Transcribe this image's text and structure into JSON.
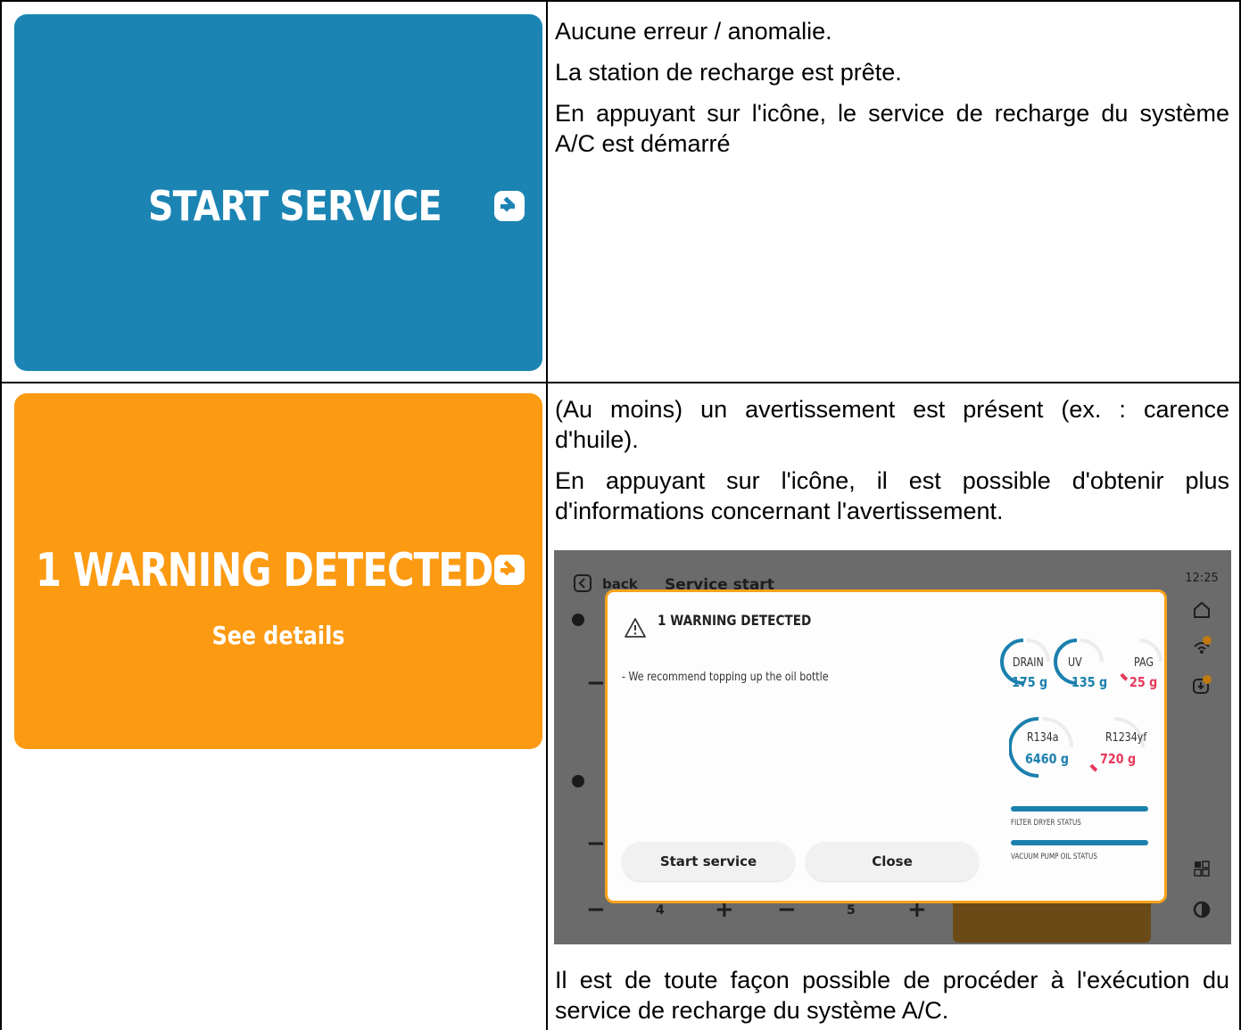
{
  "row1": {
    "tile_label": "START SERVICE",
    "paragraphs": [
      "Aucune erreur / anomalie.",
      "La station de recharge est prête.",
      "En appuyant sur l'icône, le service de recharge du système A/C est démarré"
    ]
  },
  "row2": {
    "tile_label": "1 WARNING DETECTED",
    "tile_sublabel": "See details",
    "paragraphs": [
      "(Au moins) un avertissement est présent (ex. : carence d'huile).",
      "En appuyant sur l'icône, il est possible d'obtenir plus d'informations concernant l'avertissement.",
      "Il est de toute façon possible de procéder à l'exécution du service de recharge du système A/C."
    ]
  },
  "screenshot": {
    "back_label": "back",
    "page_title": "Service start",
    "time": "12:25",
    "stepper_values": [
      "4",
      "5"
    ],
    "modal": {
      "title": "1 WARNING DETECTED",
      "message": "- We recommend topping up the oil bottle",
      "start_button": "Start service",
      "close_button": "Close",
      "gauges": [
        {
          "name": "DRAIN",
          "value": "175 g",
          "status": "ok"
        },
        {
          "name": "UV",
          "value": "135 g",
          "status": "ok"
        },
        {
          "name": "PAG",
          "value": "25 g",
          "status": "low"
        },
        {
          "name": "R134a",
          "value": "6460 g",
          "status": "ok"
        },
        {
          "name": "R1234yf",
          "value": "720 g",
          "status": "low"
        }
      ],
      "status_bars": [
        {
          "label": "FILTER DRYER STATUS"
        },
        {
          "label": "VACUUM PUMP OIL STATUS"
        }
      ]
    }
  },
  "colors": {
    "start_tile": "#1b84b3",
    "warning_tile": "#fc9a12",
    "ok_value": "#1b80ad",
    "low_value": "#e6395a",
    "modal_border": "#f7a21b"
  }
}
